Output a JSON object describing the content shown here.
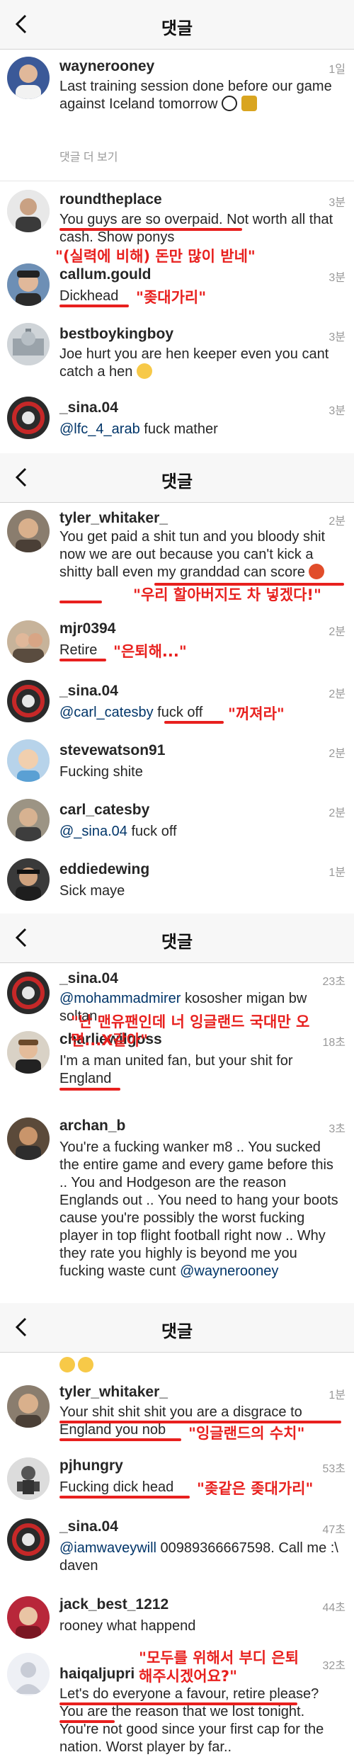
{
  "header_title": "댓글",
  "panel1": {
    "caption": {
      "username": "waynerooney",
      "time": "1일",
      "text": "Last training session done before our game against Iceland tomorrow"
    },
    "more_label": "댓글 더 보기",
    "comments": [
      {
        "username": "roundtheplace",
        "time": "3분",
        "text_a": "You guys are so overpaid.",
        "text_b": " Not worth all that cash. Show ponys",
        "annotation": "\"(실력에 비해) 돈만 많이 받네\""
      },
      {
        "username": "callum.gould",
        "time": "3분",
        "text": "Dickhead",
        "annotation": "\"좆대가리\""
      },
      {
        "username": "bestboykingboy",
        "time": "3분",
        "text": "Joe hurt you are hen keeper  even you cant catch a hen"
      },
      {
        "username": "_sina.04",
        "time": "3분",
        "mention": "@lfc_4_arab",
        "text": " fuck mather"
      }
    ]
  },
  "panel2": {
    "comments": [
      {
        "username": "tyler_whitaker_",
        "time": "2분",
        "text": "You get paid a shit tun and you bloody shit now we are out because you can't kick a shitty ball even my granddad can score",
        "annotation": "\"우리 할아버지도 차 넣겠다!\""
      },
      {
        "username": "mjr0394",
        "time": "2분",
        "text": "Retire",
        "annotation": "\"은퇴해...\""
      },
      {
        "username": "_sina.04",
        "time": "2분",
        "mention": "@carl_catesby",
        "text": " fuck off",
        "annotation": "\"꺼져라\""
      },
      {
        "username": "stevewatson91",
        "time": "2분",
        "text": "Fucking shite"
      },
      {
        "username": "carl_catesby",
        "time": "2분",
        "mention": "@_sina.04",
        "text": " fuck off"
      },
      {
        "username": "eddiedewing",
        "time": "1분",
        "text": "Sick maye"
      }
    ]
  },
  "panel3": {
    "comments": [
      {
        "username": "_sina.04",
        "time": "23초",
        "mention": "@mohammadmirer",
        "text": " kososher migan bw soltan"
      },
      {
        "username": "charliewilgoss",
        "time": "18초",
        "text": "I'm a man united fan, but your shit for England",
        "annotation": "\"난 맨유팬인데 너 잉글랜드 국대만 오면...X같아\""
      },
      {
        "username": "archan_b",
        "time": "3초",
        "text": "You're a fucking wanker m8 .. You sucked the entire game and every game before this .. You and Hodgeson are the reason Englands out .. You need to hang your boots cause you're possibly the worst fucking player in top flight football right now .. Why they rate you highly is beyond me you fucking waste cunt",
        "mention": "@waynerooney"
      }
    ]
  },
  "panel4": {
    "comments": [
      {
        "username": "tyler_whitaker_",
        "time": "1분",
        "text": "Your shit shit shit you are a disgrace to England you nob",
        "annotation": "\"잉글랜드의 수치\""
      },
      {
        "username": "pjhungry",
        "time": "53초",
        "text": "Fucking dick head",
        "annotation": "\"좆같은 좆대가리\""
      },
      {
        "username": "_sina.04",
        "time": "47초",
        "mention": "@iamwaveywill",
        "text": " 00989366667598. Call me :\\ daven"
      },
      {
        "username": "jack_best_1212",
        "time": "44초",
        "text": "rooney what happend"
      },
      {
        "username": "haiqaljupri",
        "time": "32초",
        "text": "Let's do everyone a favour, retire please? You are the reason that we lost tonight. You're not good since your first cap for the nation. Worst player by far..",
        "annotation": "\"모두를 위해서 부디 은퇴해주시겠어요?\""
      }
    ]
  },
  "colors": {
    "annotation": "#e8201e",
    "mention": "#003569",
    "timestamp": "#999999"
  }
}
